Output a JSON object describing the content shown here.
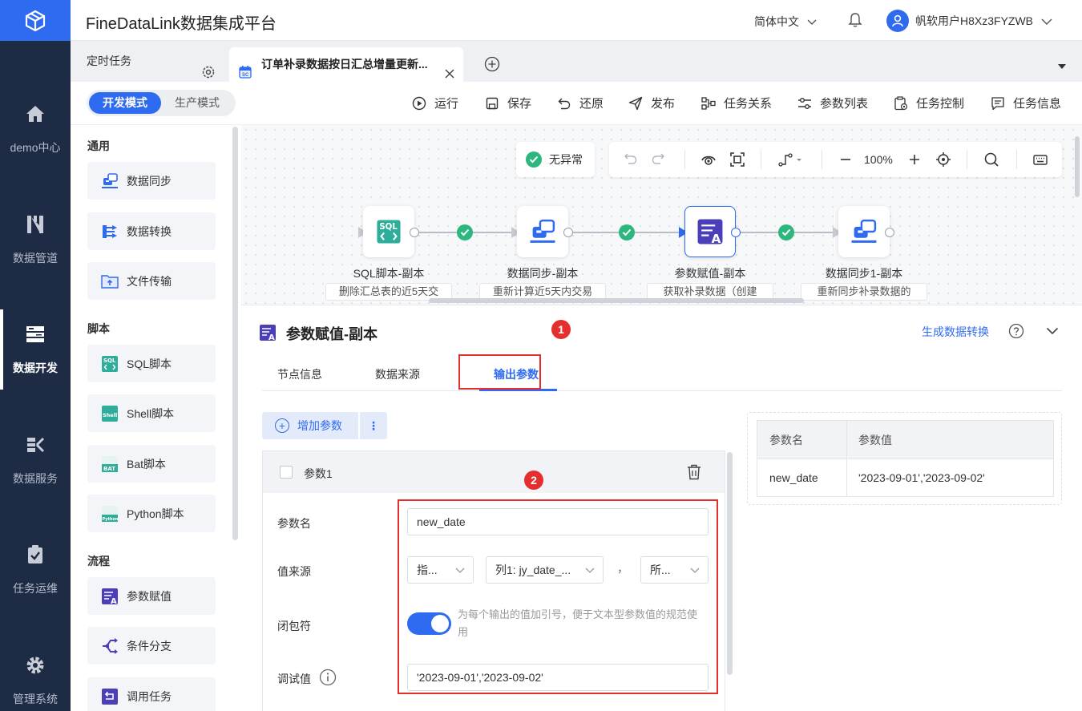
{
  "app": {
    "title": "FineDataLink数据集成平台",
    "language": "简体中文",
    "username": "帆软用户H8Xz3FYZWB"
  },
  "nav": {
    "items": [
      {
        "id": "demo",
        "label": "demo中心",
        "icon": "home-icon"
      },
      {
        "id": "pipeline",
        "label": "数据管道",
        "icon": "pipeline-icon"
      },
      {
        "id": "dev",
        "label": "数据开发",
        "icon": "dev-icon",
        "active": true
      },
      {
        "id": "service",
        "label": "数据服务",
        "icon": "service-icon"
      },
      {
        "id": "ops",
        "label": "任务运维",
        "icon": "ops-icon"
      },
      {
        "id": "admin",
        "label": "管理系统",
        "icon": "gear-icon"
      }
    ]
  },
  "tabs": {
    "scheduled": "定时任务",
    "active_tab": "订单补录数据按日汇总增量更新..."
  },
  "mode": {
    "dev": "开发模式",
    "prod": "生产模式"
  },
  "toolbar": {
    "run": "运行",
    "save": "保存",
    "restore": "还原",
    "publish": "发布",
    "relations": "任务关系",
    "params": "参数列表",
    "control": "任务控制",
    "info": "任务信息"
  },
  "components": {
    "sections": {
      "common": "通用",
      "script": "脚本",
      "flow": "流程"
    },
    "common": [
      "数据同步",
      "数据转换",
      "文件传输"
    ],
    "script": [
      "SQL脚本",
      "Shell脚本",
      "Bat脚本",
      "Python脚本"
    ],
    "flow": [
      "参数赋值",
      "条件分支",
      "调用任务"
    ]
  },
  "canvas": {
    "status": "无异常",
    "zoom": "100%",
    "nodes": [
      {
        "label": "SQL脚本-副本",
        "desc": "删除汇总表的近5天交",
        "icon": "sql-icon"
      },
      {
        "label": "数据同步-副本",
        "desc": "重新计算近5天内交易",
        "icon": "sync-icon"
      },
      {
        "label": "参数赋值-副本",
        "desc": "获取补录数据（创建",
        "icon": "param-assign-icon"
      },
      {
        "label": "数据同步1-副本",
        "desc": "重新同步补录数据的",
        "icon": "sync-icon"
      }
    ]
  },
  "detail": {
    "title": "参数赋值-副本",
    "gen_link": "生成数据转换",
    "badge1": "1",
    "badge2": "2",
    "subtabs": [
      "节点信息",
      "数据来源",
      "输出参数"
    ],
    "add_param": "增加参数",
    "more": "⋮",
    "param": {
      "header": "参数1",
      "name_label": "参数名",
      "name_value": "new_date",
      "source_label": "值来源",
      "source_select1": "指...",
      "source_select2": "列1: jy_date_...",
      "source_sep": "，",
      "source_select3": "所...",
      "wrap_label": "闭包符",
      "wrap_on": true,
      "wrap_desc": "为每个输出的值加引号，便于文本型参数值的规范使用",
      "debug_label": "调试值",
      "debug_value": "'2023-09-01','2023-09-02'"
    },
    "result": {
      "col_name": "参数名",
      "col_value": "参数值",
      "row_name": "new_date",
      "row_value": "'2023-09-01','2023-09-02'"
    }
  }
}
